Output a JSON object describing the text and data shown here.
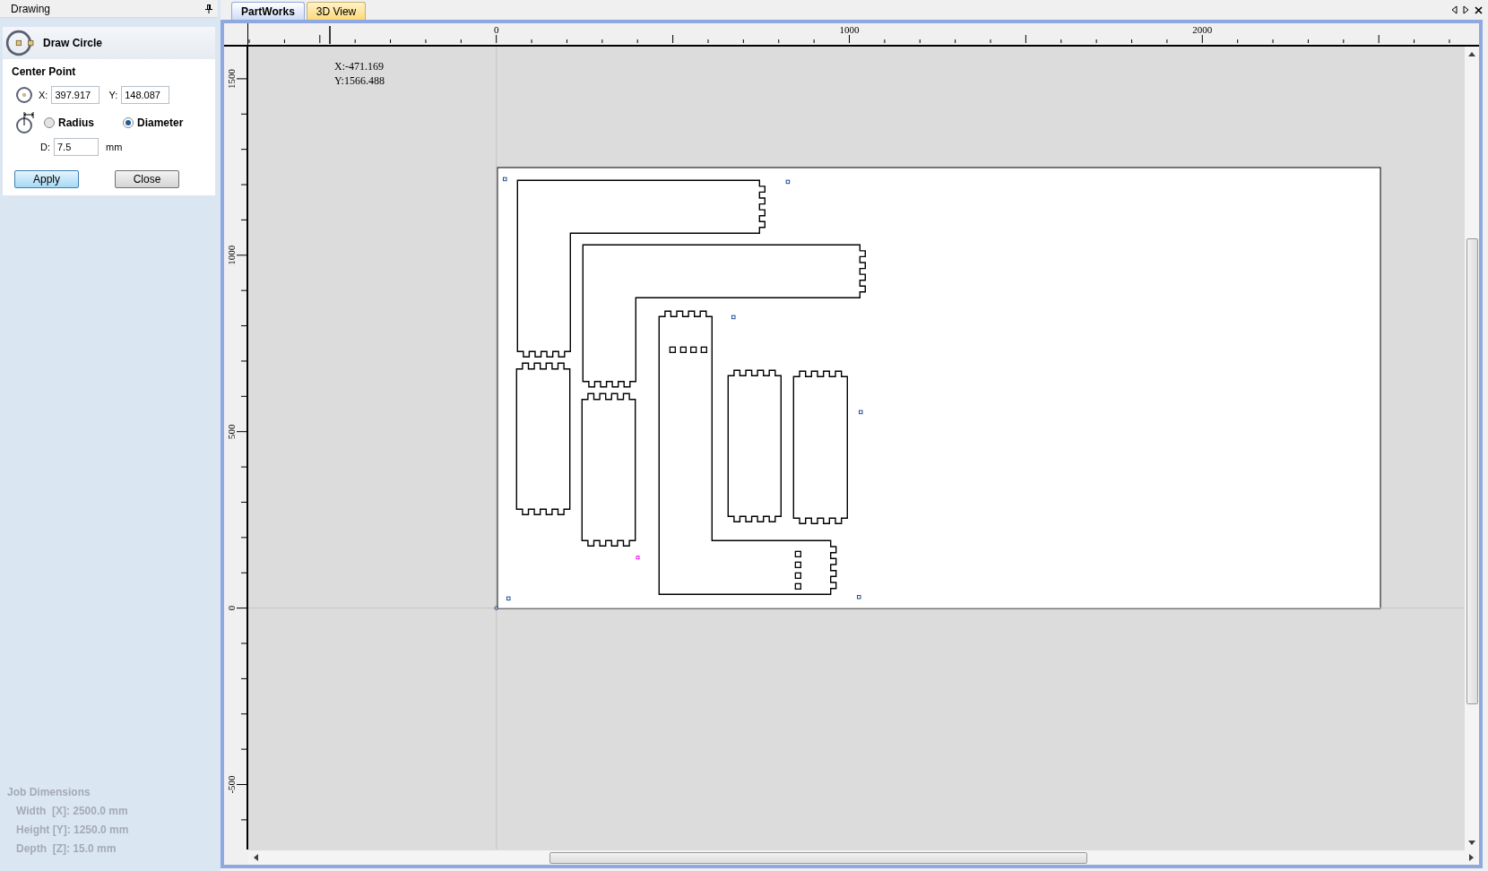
{
  "panel": {
    "title": "Drawing"
  },
  "tool": {
    "title": "Draw Circle"
  },
  "center_point": {
    "heading": "Center Point",
    "x_label": "X:",
    "x_value": "397.917",
    "y_label": "Y:",
    "y_value": "148.087"
  },
  "size_mode": [
    {
      "label": "Radius",
      "selected": false
    },
    {
      "label": "Diameter",
      "selected": true
    }
  ],
  "size": {
    "label": "D:",
    "value": "7.5",
    "unit": "mm"
  },
  "buttons": [
    {
      "label": "Apply",
      "focused": true
    },
    {
      "label": "Close",
      "focused": false
    }
  ],
  "job_dimensions": {
    "heading": "Job Dimensions",
    "lines": [
      "Width  [X]: 2500.0 mm",
      "Height [Y]: 1250.0 mm",
      "Depth  [Z]: 15.0 mm"
    ]
  },
  "tabs": [
    {
      "label": "PartWorks",
      "selected": true
    },
    {
      "label": "3D View",
      "selected": false
    }
  ],
  "top_ruler": {
    "labels": [
      "0",
      "1000",
      "2000"
    ]
  },
  "left_ruler": {
    "labels": [
      "1500",
      "1000",
      "500",
      "0",
      "-500"
    ]
  },
  "cursor_readout": [
    "X:-471.169",
    "Y:1566.488"
  ]
}
